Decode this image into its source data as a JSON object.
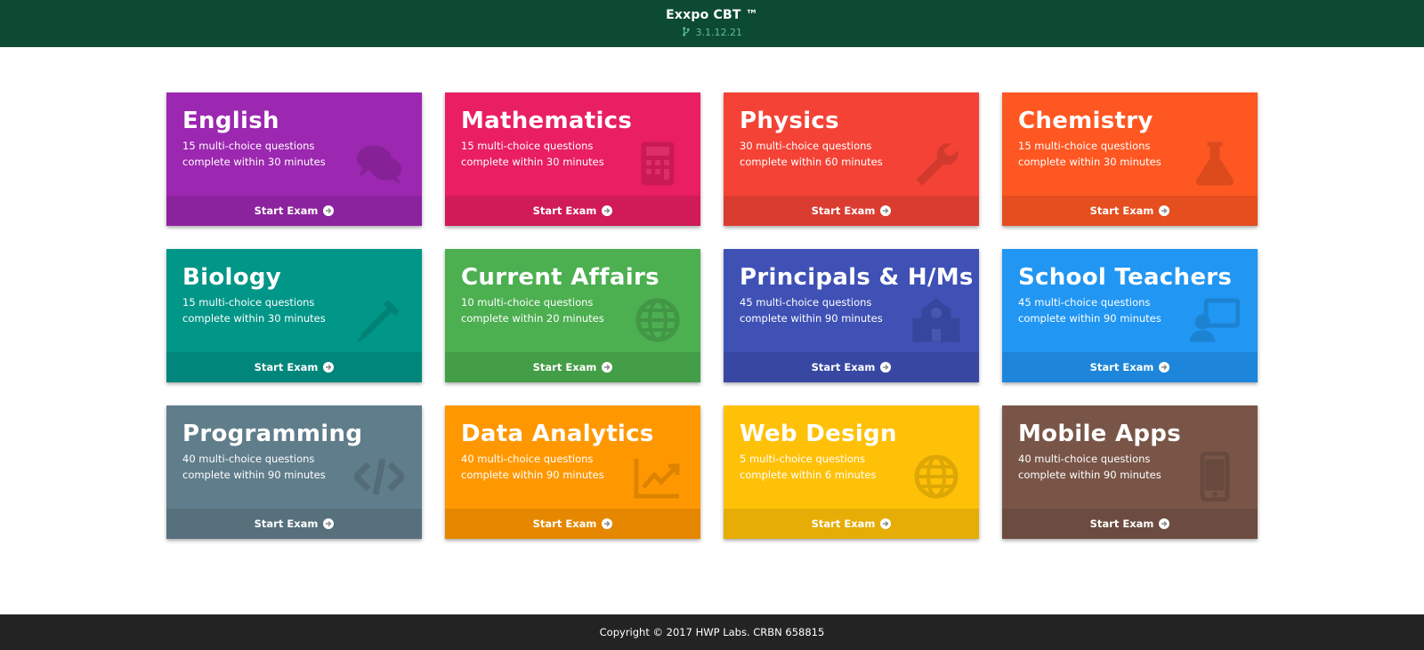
{
  "header": {
    "title": "Exxpo CBT ™",
    "version": "3.1.12.21"
  },
  "cards": [
    {
      "title": "English",
      "line1": "15 multi-choice questions",
      "line2": "complete within 30 minutes",
      "button": "Start Exam",
      "icon": "chat-bubbles-icon",
      "color": "#9c27b0"
    },
    {
      "title": "Mathematics",
      "line1": "15 multi-choice questions",
      "line2": "complete within 30 minutes",
      "button": "Start Exam",
      "icon": "calculator-icon",
      "color": "#e91e63"
    },
    {
      "title": "Physics",
      "line1": "30 multi-choice questions",
      "line2": "complete within 60 minutes",
      "button": "Start Exam",
      "icon": "wrench-icon",
      "color": "#f44336"
    },
    {
      "title": "Chemistry",
      "line1": "15 multi-choice questions",
      "line2": "complete within 30 minutes",
      "button": "Start Exam",
      "icon": "flask-icon",
      "color": "#ff5722"
    },
    {
      "title": "Biology",
      "line1": "15 multi-choice questions",
      "line2": "complete within 30 minutes",
      "button": "Start Exam",
      "icon": "syringe-icon",
      "color": "#009688"
    },
    {
      "title": "Current Affairs",
      "line1": "10 multi-choice questions",
      "line2": "complete within 20 minutes",
      "button": "Start Exam",
      "icon": "globe-icon",
      "color": "#4caf50"
    },
    {
      "title": "Principals & H/Ms",
      "line1": "45 multi-choice questions",
      "line2": "complete within 90 minutes",
      "button": "Start Exam",
      "icon": "school-icon",
      "color": "#3f51b5"
    },
    {
      "title": "School Teachers",
      "line1": "45 multi-choice questions",
      "line2": "complete within 90 minutes",
      "button": "Start Exam",
      "icon": "teacher-board-icon",
      "color": "#2196f3"
    },
    {
      "title": "Programming",
      "line1": "40 multi-choice questions",
      "line2": "complete within 90 minutes",
      "button": "Start Exam",
      "icon": "code-icon",
      "color": "#607d8b"
    },
    {
      "title": "Data Analytics",
      "line1": "40 multi-choice questions",
      "line2": "complete within 90 minutes",
      "button": "Start Exam",
      "icon": "trending-chart-icon",
      "color": "#ff9800"
    },
    {
      "title": "Web Design",
      "line1": "5 multi-choice questions",
      "line2": "complete within 6 minutes",
      "button": "Start Exam",
      "icon": "globe-icon",
      "color": "#ffc107"
    },
    {
      "title": "Mobile Apps",
      "line1": "40 multi-choice questions",
      "line2": "complete within 90 minutes",
      "button": "Start Exam",
      "icon": "smartphone-icon",
      "color": "#795548"
    }
  ],
  "footer": {
    "copyright": "Copyright © 2017 HWP Labs. CRBN 658815"
  }
}
